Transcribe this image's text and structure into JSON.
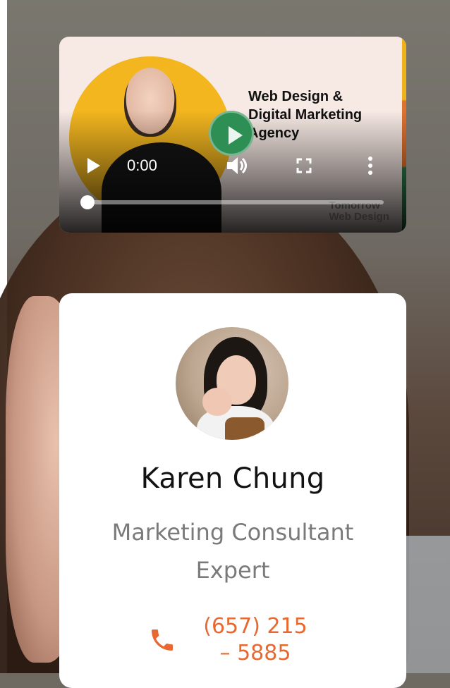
{
  "video": {
    "title": "Web Design &\nDigital Marketing\nAgency",
    "brand_watermark": "Tomorrow\nWeb Design",
    "current_time": "0:00",
    "progress_fraction": 0.0
  },
  "profile": {
    "name": "Karen Chung",
    "role": "Marketing Consultant Expert",
    "phone": "(657) 215\n– 5885"
  },
  "colors": {
    "accent_orange": "#e8682f",
    "play_green": "#2e8f55",
    "card_bg": "#ffffff"
  },
  "icons": [
    "play-icon",
    "volume-icon",
    "fullscreen-icon",
    "more-vert-icon",
    "phone-icon"
  ]
}
